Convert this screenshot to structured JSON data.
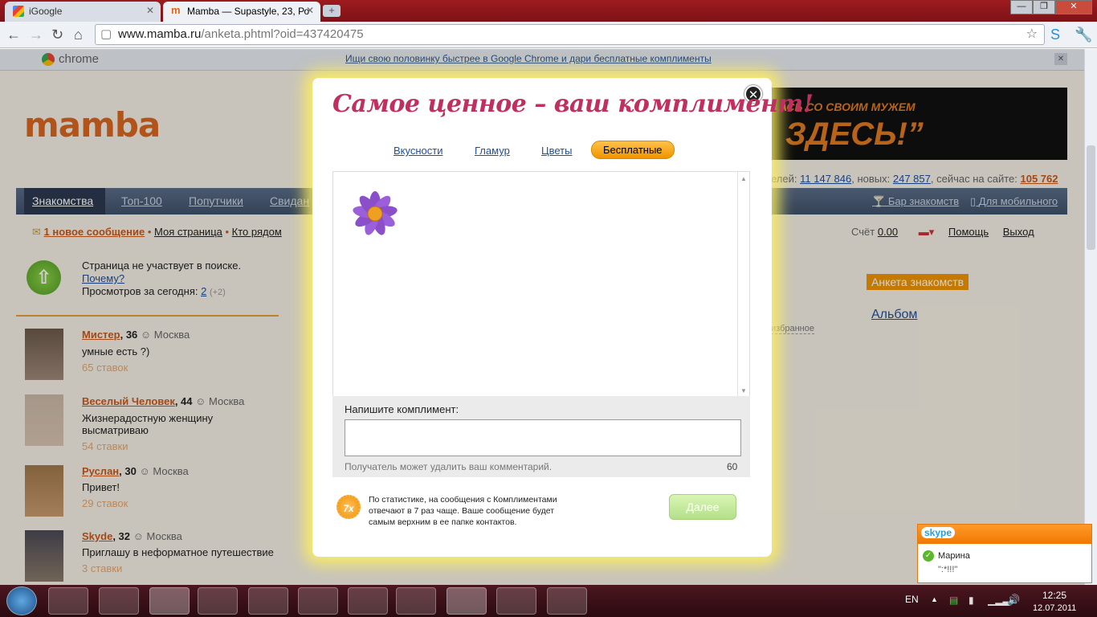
{
  "browser": {
    "tabs": [
      {
        "label": "iGoogle"
      },
      {
        "label": "Mamba — Supastyle, 23, Ро"
      }
    ],
    "url_host": "www.mamba.ru",
    "url_path": "/anketa.phtml?oid=437420475"
  },
  "chrome_promo": {
    "brand": "chrome",
    "link": "Ищи свою половинку быстрее в Google Chrome и дари бесплатные комплименты"
  },
  "site": {
    "logo": "mamba",
    "banner_top": "АСЬ СО СВОИМ МУЖЕМ",
    "banner_big": "ЗДЕСЬ!”",
    "stats": {
      "users_tail": "елей:",
      "users": "11 147 846",
      "new_label": ", новых:",
      "new": "247 857",
      "online_label": ", сейчас на сайте:",
      "online": "105 762"
    },
    "nav": [
      "Знакомства",
      "Топ-100",
      "Попутчики",
      "Свидан"
    ],
    "nav_right": [
      "Бар знакомств",
      "Для мобильного"
    ],
    "subnav": {
      "new_message": "1 новое сообщение",
      "my_page": "Моя страница",
      "nearby": "Кто рядом"
    },
    "account": {
      "score_label": "Счёт",
      "score": "0.00",
      "help": "Помощь",
      "logout": "Выход"
    },
    "search_notice": {
      "line1": "Страница не участвует в поиске.",
      "why": "Почему?",
      "views_label": "Просмотров за сегодня:",
      "views": "2",
      "views_delta": "(+2)"
    },
    "right": {
      "anketa": "Анкета знакомств",
      "album": "Альбом",
      "fav": "избранное"
    },
    "people": [
      {
        "name": "Мистер",
        "age": ", 36",
        "city": "Москва",
        "text": "умные есть ?)",
        "bids": "65 ставок"
      },
      {
        "name": "Веселый Человек",
        "age": ", 44",
        "city": "Москва",
        "text": "Жизнерадостную женщину высматриваю",
        "bids": "54 ставки"
      },
      {
        "name": "Руслан",
        "age": ", 30",
        "city": "Москва",
        "text": "Привет!",
        "bids": "29 ставок"
      },
      {
        "name": "Skyde",
        "age": ", 32",
        "city": "Москва",
        "text": "Приглашу в неформатное путешествие",
        "bids": "3 ставки"
      }
    ]
  },
  "modal": {
    "title": "Самое ценное – ваш комплимент!",
    "tabs": [
      "Вкусности",
      "Гламур",
      "Цветы",
      "Бесплатные"
    ],
    "write_label": "Напишите комплимент:",
    "note": "Получатель может удалить ваш комментарий.",
    "counter": "60",
    "badge": "7x",
    "stats_text": "По статистике, на сообщения с Комплиментами отвечают в 7 раз чаще. Ваше сообщение будет самым верхним в ее папке контактов.",
    "next": "Далее"
  },
  "skype_popup": {
    "brand": "skype",
    "contact": "Марина",
    "message": "\":*!!!\""
  },
  "taskbar": {
    "lang": "EN",
    "time": "12:25",
    "date": "12.07.2011"
  },
  "colors": {
    "accent_orange": "#f09400",
    "title_pink": "#c0305e",
    "link_blue": "#1f4f9a",
    "brand_orange": "#c9581a"
  }
}
